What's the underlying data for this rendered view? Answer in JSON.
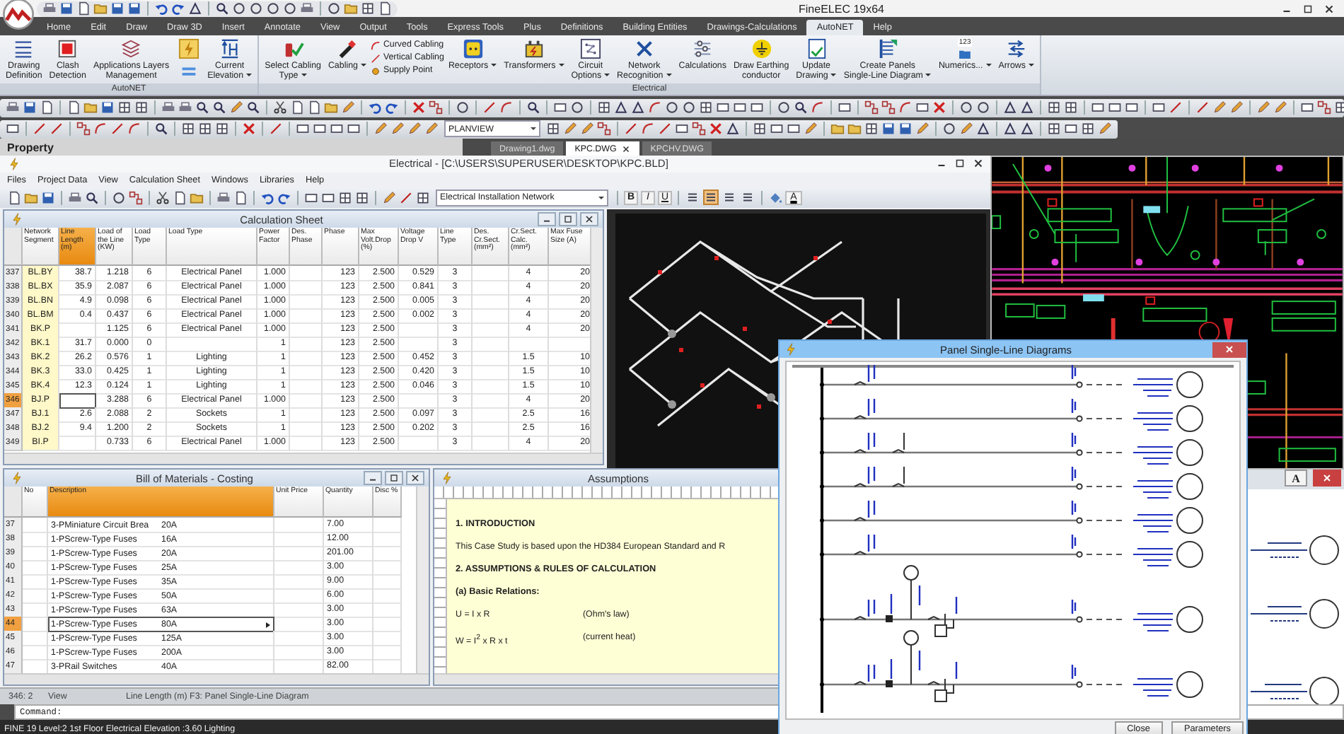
{
  "window": {
    "title": "FineELEC 19x64"
  },
  "ribbon": {
    "tabs": [
      {
        "label": "Home",
        "selected": false
      },
      {
        "label": "Edit",
        "selected": false
      },
      {
        "label": "Draw",
        "selected": false
      },
      {
        "label": "Draw 3D",
        "selected": false
      },
      {
        "label": "Insert",
        "selected": false
      },
      {
        "label": "Annotate",
        "selected": false
      },
      {
        "label": "View",
        "selected": false
      },
      {
        "label": "Output",
        "selected": false
      },
      {
        "label": "Tools",
        "selected": false
      },
      {
        "label": "Express Tools",
        "selected": false
      },
      {
        "label": "Plus",
        "selected": false
      },
      {
        "label": "Definitions",
        "selected": false
      },
      {
        "label": "Building Entities",
        "selected": false
      },
      {
        "label": "Drawings-Calculations",
        "selected": false
      },
      {
        "label": "AutoNET",
        "selected": true
      },
      {
        "label": "Help",
        "selected": false
      }
    ],
    "groups": [
      {
        "label": "AutoNET",
        "items": [
          {
            "kind": "large",
            "label": "Drawing\nDefinition",
            "dropdown": false
          },
          {
            "kind": "large",
            "label": "Clash\nDetection",
            "dropdown": false
          },
          {
            "kind": "large",
            "label": "Applications Layers\nManagement",
            "dropdown": false
          },
          {
            "kind": "icon-pair"
          },
          {
            "kind": "large",
            "label": "Current\nElevation",
            "dropdown": true
          }
        ]
      },
      {
        "label": "Electrical",
        "items": [
          {
            "kind": "large",
            "label": "Select Cabling\nType",
            "dropdown": true
          },
          {
            "kind": "large",
            "label": "Cabling",
            "dropdown": true
          },
          {
            "kind": "stack",
            "entries": [
              "Curved Cabling",
              "Vertical Cabling",
              "Supply Point"
            ]
          },
          {
            "kind": "large",
            "label": "Receptors",
            "dropdown": true
          },
          {
            "kind": "large",
            "label": "Transformers",
            "dropdown": true
          },
          {
            "kind": "large",
            "label": "Circuit\nOptions",
            "dropdown": true
          },
          {
            "kind": "large",
            "label": "Network\nRecognition",
            "dropdown": true
          },
          {
            "kind": "large",
            "label": "Calculations",
            "dropdown": false
          },
          {
            "kind": "large",
            "label": "Draw Earthing\nconductor",
            "dropdown": false
          },
          {
            "kind": "large",
            "label": "Update\nDrawing",
            "dropdown": true
          },
          {
            "kind": "large",
            "label": "Create Panels\nSingle-Line Diagram",
            "dropdown": true
          },
          {
            "kind": "large",
            "label": "Numerics...",
            "badge": "123",
            "dropdown": true
          },
          {
            "kind": "large",
            "label": "Arrows",
            "dropdown": true
          }
        ]
      }
    ]
  },
  "toolbar": {
    "view_dropdown": "PLANVIEW"
  },
  "property_panel": {
    "title": "Property"
  },
  "document_tabs": [
    {
      "label": "Drawing1.dwg",
      "selected": false
    },
    {
      "label": "KPC.DWG",
      "selected": true
    },
    {
      "label": "KPCHV.DWG",
      "selected": false
    }
  ],
  "electrical_window": {
    "title": "Electrical - [C:\\USERS\\SUPERUSER\\DESKTOP\\KPC.BLD]",
    "menu": [
      "Files",
      "Project Data",
      "View",
      "Calculation Sheet",
      "Windows",
      "Libraries",
      "Help"
    ],
    "style_dropdown": "Electrical Installation Network",
    "format_buttons": [
      "B",
      "I",
      "U"
    ],
    "align_buttons": [
      {
        "selected": false
      },
      {
        "selected": true
      },
      {
        "selected": false
      },
      {
        "selected": false
      }
    ],
    "font_color_button": "A"
  },
  "calc_sheet": {
    "title": "Calculation Sheet",
    "columns": [
      {
        "label": "Network Segment",
        "selected": false
      },
      {
        "label": "Line Length (m)",
        "selected": true
      },
      {
        "label": "Load of the Line (KW)",
        "selected": false
      },
      {
        "label": "Load Type",
        "selected": false
      },
      {
        "label": "Load Type",
        "selected": false
      },
      {
        "label": "Power Factor",
        "selected": false
      },
      {
        "label": "Des. Phase",
        "selected": false
      },
      {
        "label": "Phase",
        "selected": false
      },
      {
        "label": "Max Volt.Drop (%)",
        "selected": false
      },
      {
        "label": "Voltage Drop V",
        "selected": false
      },
      {
        "label": "Line Type",
        "selected": false
      },
      {
        "label": "Des. Cr.Sect. (mm²)",
        "selected": false
      },
      {
        "label": "Cr.Sect. Calc. (mm²)",
        "selected": false
      },
      {
        "label": "Max Fuse Size (A)",
        "selected": false
      }
    ],
    "rows": [
      {
        "num": "337",
        "selected": false,
        "cells": [
          "BL.BY",
          "38.7",
          "1.218",
          "6",
          "Electrical Panel",
          "1.000",
          null,
          "123",
          "2.500",
          "0.529",
          "3",
          null,
          "4",
          "20"
        ]
      },
      {
        "num": "338",
        "selected": false,
        "cells": [
          "BL.BX",
          "35.9",
          "2.087",
          "6",
          "Electrical Panel",
          "1.000",
          null,
          "123",
          "2.500",
          "0.841",
          "3",
          null,
          "4",
          "20"
        ]
      },
      {
        "num": "339",
        "selected": false,
        "cells": [
          "BL.BN",
          "4.9",
          "0.098",
          "6",
          "Electrical Panel",
          "1.000",
          null,
          "123",
          "2.500",
          "0.005",
          "3",
          null,
          "4",
          "20"
        ]
      },
      {
        "num": "340",
        "selected": false,
        "cells": [
          "BL.BM",
          "0.4",
          "0.437",
          "6",
          "Electrical Panel",
          "1.000",
          null,
          "123",
          "2.500",
          "0.002",
          "3",
          null,
          "4",
          "20"
        ]
      },
      {
        "num": "341",
        "selected": false,
        "cells": [
          "BK.P",
          null,
          "1.125",
          "6",
          "Electrical Panel",
          "1.000",
          null,
          "123",
          "2.500",
          null,
          "3",
          null,
          "4",
          "20"
        ]
      },
      {
        "num": "342",
        "selected": false,
        "cells": [
          "BK.1",
          "31.7",
          "0.000",
          "0",
          null,
          "1",
          null,
          "123",
          "2.500",
          null,
          "3",
          null,
          null,
          null
        ]
      },
      {
        "num": "343",
        "selected": false,
        "cells": [
          "BK.2",
          "26.2",
          "0.576",
          "1",
          "Lighting",
          "1",
          null,
          "123",
          "2.500",
          "0.452",
          "3",
          null,
          "1.5",
          "10"
        ]
      },
      {
        "num": "344",
        "selected": false,
        "cells": [
          "BK.3",
          "33.0",
          "0.425",
          "1",
          "Lighting",
          "1",
          null,
          "123",
          "2.500",
          "0.420",
          "3",
          null,
          "1.5",
          "10"
        ]
      },
      {
        "num": "345",
        "selected": false,
        "cells": [
          "BK.4",
          "12.3",
          "0.124",
          "1",
          "Lighting",
          "1",
          null,
          "123",
          "2.500",
          "0.046",
          "3",
          null,
          "1.5",
          "10"
        ]
      },
      {
        "num": "346",
        "selected": true,
        "cells": [
          "BJ.P",
          null,
          "3.288",
          "6",
          "Electrical Panel",
          "1.000",
          null,
          "123",
          "2.500",
          null,
          "3",
          null,
          "4",
          "20"
        ]
      },
      {
        "num": "347",
        "selected": false,
        "cells": [
          "BJ.1",
          "2.6",
          "2.088",
          "2",
          "Sockets",
          "1",
          null,
          "123",
          "2.500",
          "0.097",
          "3",
          null,
          "2.5",
          "16"
        ]
      },
      {
        "num": "348",
        "selected": false,
        "cells": [
          "BJ.2",
          "9.4",
          "1.200",
          "2",
          "Sockets",
          "1",
          null,
          "123",
          "2.500",
          "0.202",
          "3",
          null,
          "2.5",
          "16"
        ]
      },
      {
        "num": "349",
        "selected": false,
        "cells": [
          "BI.P",
          null,
          "0.733",
          "6",
          "Electrical Panel",
          "1.000",
          null,
          "123",
          "2.500",
          null,
          "3",
          null,
          "4",
          "20"
        ]
      }
    ]
  },
  "bom": {
    "title": "Bill of Materials - Costing",
    "columns": [
      {
        "label": "No",
        "selected": false
      },
      {
        "label": "Description",
        "selected": true
      },
      {
        "label": "Unit Price",
        "selected": false
      },
      {
        "label": "Quantity",
        "selected": false
      },
      {
        "label": "Disc %",
        "selected": false
      }
    ],
    "rows": [
      {
        "num": "37",
        "selected": false,
        "description": "3-PMiniature Circuit Brea",
        "rating": "20A",
        "quantity": "7.00"
      },
      {
        "num": "38",
        "selected": false,
        "description": "1-PScrew-Type Fuses",
        "rating": "16A",
        "quantity": "12.00"
      },
      {
        "num": "39",
        "selected": false,
        "description": "1-PScrew-Type Fuses",
        "rating": "20A",
        "quantity": "201.00"
      },
      {
        "num": "40",
        "selected": false,
        "description": "1-PScrew-Type Fuses",
        "rating": "25A",
        "quantity": "3.00"
      },
      {
        "num": "41",
        "selected": false,
        "description": "1-PScrew-Type Fuses",
        "rating": "35A",
        "quantity": "9.00"
      },
      {
        "num": "42",
        "selected": false,
        "description": "1-PScrew-Type Fuses",
        "rating": "50A",
        "quantity": "6.00"
      },
      {
        "num": "43",
        "selected": false,
        "description": "1-PScrew-Type Fuses",
        "rating": "63A",
        "quantity": "3.00"
      },
      {
        "num": "44",
        "selected": true,
        "description": "1-PScrew-Type Fuses",
        "rating": "80A",
        "quantity": "3.00"
      },
      {
        "num": "45",
        "selected": false,
        "description": "1-PScrew-Type Fuses",
        "rating": "125A",
        "quantity": "3.00"
      },
      {
        "num": "46",
        "selected": false,
        "description": "1-PScrew-Type Fuses",
        "rating": "200A",
        "quantity": "3.00"
      },
      {
        "num": "47",
        "selected": false,
        "description": "3-PRail Switches",
        "rating": "40A",
        "quantity": "82.00"
      }
    ]
  },
  "assumptions": {
    "title": "Assumptions",
    "blocks": [
      {
        "kind": "heading",
        "text": "1. INTRODUCTION"
      },
      {
        "kind": "paragraph",
        "text": "This Case Study is based upon the HD384 European Standard and R"
      },
      {
        "kind": "heading",
        "text": "2. ASSUMPTIONS  & RULES OF CALCULATION"
      },
      {
        "kind": "heading",
        "text": "(a) Basic Relations:"
      },
      {
        "kind": "formula",
        "text": "U = I x R",
        "note": "(Ohm's law)"
      },
      {
        "kind": "formula",
        "text": "W = I$^{2}$ x R x t",
        "note": "(current heat)"
      }
    ]
  },
  "status_line": [
    "346: 2",
    "View",
    "Line Length (m) F3: Panel Single-Line Diagram"
  ],
  "dialog": {
    "title": "Panel Single-Line Diagrams",
    "buttons": [
      "Close",
      "Parameters"
    ]
  },
  "side_window": {
    "button": "A"
  },
  "command": {
    "prompt": "Command:"
  },
  "status_bar": {
    "text": "FINE 19 Level:2 1st Floor Electrical Elevation :3.60 Lighting"
  }
}
